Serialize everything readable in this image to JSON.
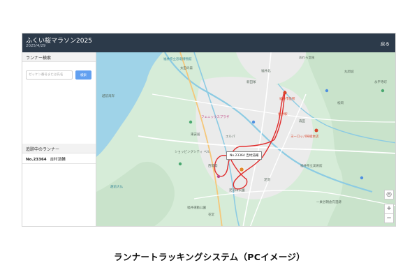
{
  "header": {
    "title": "ふくい桜マラソン2025",
    "date": "2025/4/29",
    "back_label": "戻る"
  },
  "sidebar": {
    "search_heading": "ランナー検索",
    "search_placeholder": "ゼッケン番号または氏名",
    "search_button": "検索",
    "tracking_heading": "追跡中のランナー",
    "runners": [
      {
        "bib": "No.23364",
        "name": "吉村浩輔"
      }
    ]
  },
  "map": {
    "popup_text": "No.23364 吉村浩輔",
    "labels": [
      "福井県立恐竜博物館",
      "越前海岸",
      "太田の森",
      "福井市役所",
      "あわら温泉",
      "丸岡城",
      "永平寺町",
      "福井駅",
      "足羽山公園",
      "フェニックスプラザ",
      "ヨーロッパ軒総本店",
      "ショッピングシティ ベル",
      "エルパ",
      "福井県立美術館",
      "越前大仏",
      "福井運動公園",
      "一乗谷朝倉氏遺跡",
      "新田塚",
      "西開発",
      "森田",
      "福井北",
      "花堂",
      "足羽",
      "東安居",
      "松岡"
    ],
    "controls": {
      "locate": "◎",
      "zoom_in": "+",
      "zoom_out": "−"
    }
  },
  "caption": "ランナートラッキングシステム（PCイメージ）",
  "colors": {
    "header_bg": "#2c3a4a",
    "search_button": "#62a0f0",
    "route": "#e02b2b",
    "sea": "#9fd3e8",
    "land": "#d6ecd8",
    "urban": "#ebebeb"
  }
}
